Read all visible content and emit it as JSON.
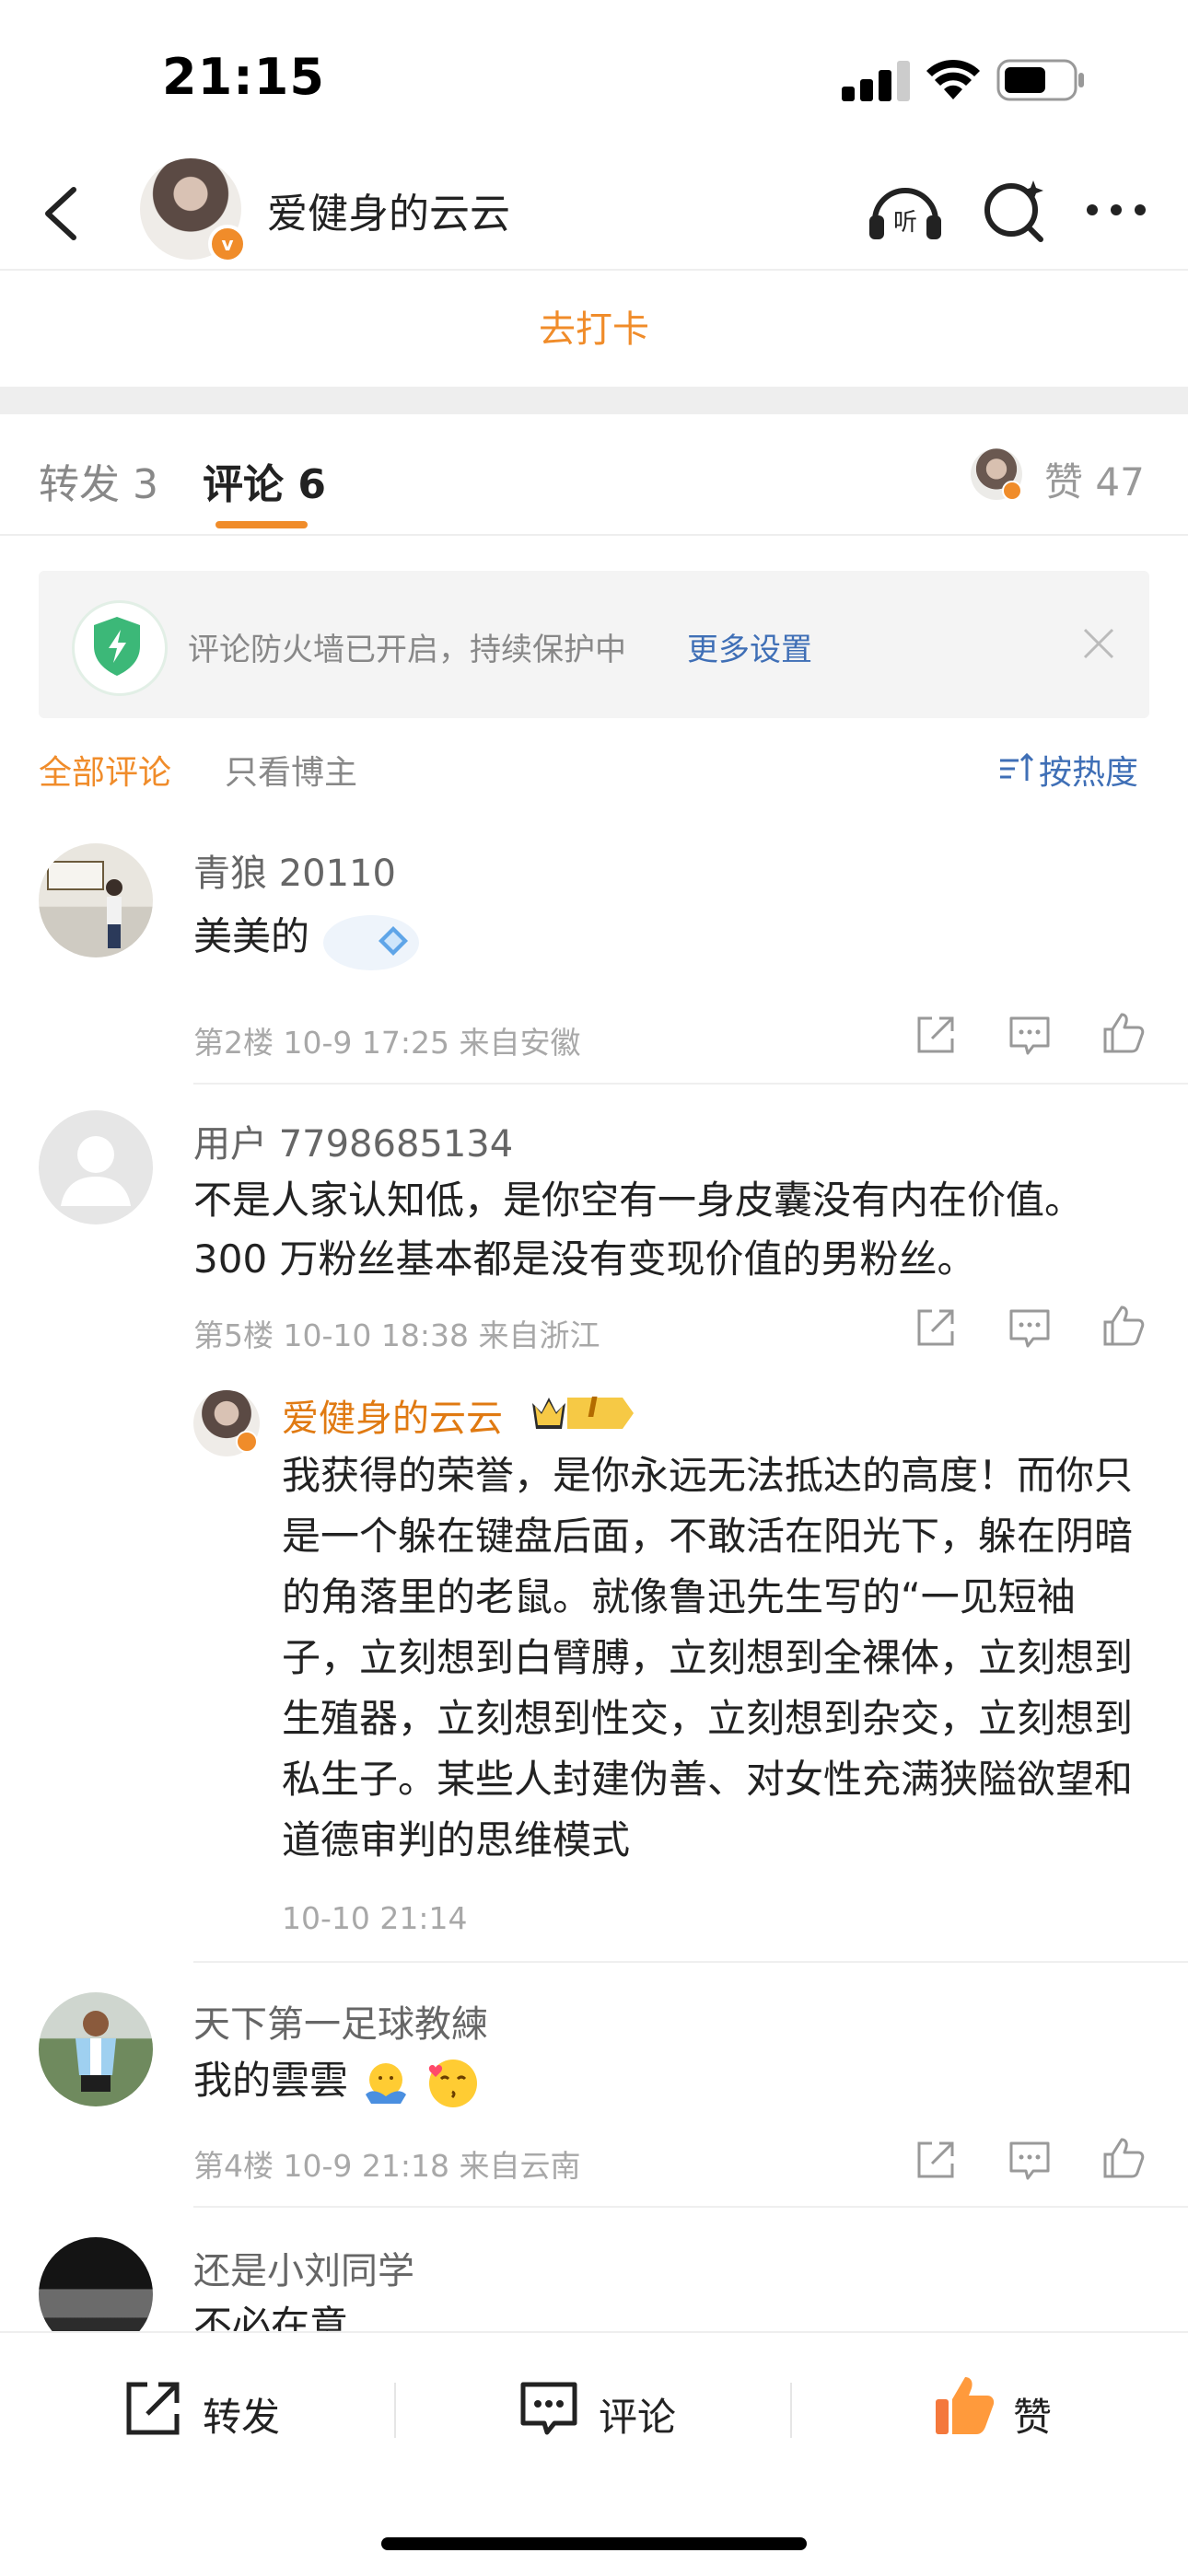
{
  "status_bar": {
    "time": "21:15"
  },
  "header": {
    "author": "爱健身的云云",
    "verified_badge": "v"
  },
  "checkin": {
    "label": "去打卡"
  },
  "tabs": [
    {
      "label": "转发 3"
    },
    {
      "label": "评论 6"
    }
  ],
  "likes": {
    "label": "赞 47"
  },
  "banner": {
    "text": "评论防火墙已开启，持续保护中",
    "link": "更多设置"
  },
  "filters": {
    "all": "全部评论",
    "host_only": "只看博主",
    "sort": "按热度"
  },
  "comments": [
    {
      "user": "青狼 20110",
      "text": "美美的",
      "meta": "第2楼 10-9 17:25 来自安徽"
    },
    {
      "user": "用户 7798685134",
      "text": "不是人家认知低，是你空有一身皮囊没有内在价值。300 万粉丝基本都是没有变现价值的男粉丝。",
      "meta": "第5楼 10-10 18:38 来自浙江",
      "reply": {
        "user": "爱健身的云云",
        "badge": "I",
        "text": "我获得的荣誉，是你永远无法抵达的高度！而你只是一个躲在键盘后面，不敢活在阳光下，躲在阴暗的角落里的老鼠。就像鲁迅先生写的“一见短袖子，立刻想到白臂膊，立刻想到全裸体，立刻想到生殖器，立刻想到性交，立刻想到杂交，立刻想到私生子。某些人封建伪善、对女性充满狭隘欲望和道德审判的思维模式",
        "time": "10-10 21:14"
      }
    },
    {
      "user": "天下第一足球教練",
      "text": "我的雲雲",
      "meta": "第4楼 10-9 21:18 来自云南"
    },
    {
      "user": "还是小刘同学",
      "text": "不必在意"
    }
  ],
  "bottom_bar": {
    "repost": "转发",
    "comment": "评论",
    "like": "赞"
  },
  "colors": {
    "accent": "#f08c2a",
    "link": "#3f6fb6",
    "shield": "#3cb878"
  },
  "icons": [
    "back-icon",
    "listen-icon",
    "search-icon",
    "more-icon",
    "shield-icon",
    "close-icon",
    "sort-icon",
    "share-icon",
    "comment-icon",
    "like-icon"
  ]
}
